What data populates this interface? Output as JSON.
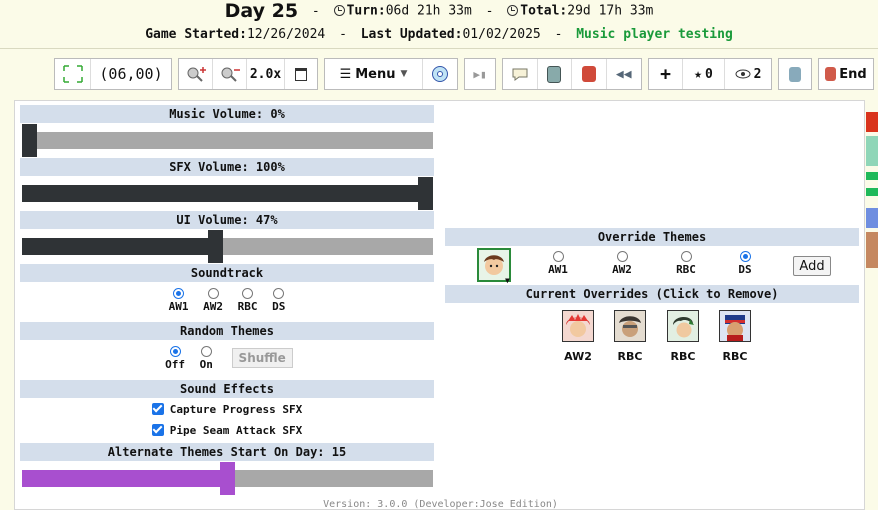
{
  "header": {
    "day": "Day 25",
    "turn_label": "Turn:",
    "turn_value": "06d 21h 33m",
    "total_label": "Total:",
    "total_value": "29d 17h 33m",
    "started_label": "Game Started:",
    "started_value": "12/26/2024",
    "updated_label": "Last Updated:",
    "updated_value": "01/02/2025",
    "status": "Music player testing"
  },
  "toolbar": {
    "coords": "(06,00)",
    "zoom": "2.0x",
    "menu": "Menu",
    "stars": "0",
    "views": "2",
    "end": "End"
  },
  "settings": {
    "music_volume": {
      "label": "Music Volume: 0%",
      "value": 0
    },
    "sfx_volume": {
      "label": "SFX Volume: 100%",
      "value": 100
    },
    "ui_volume": {
      "label": "UI Volume: 47%",
      "value": 47
    },
    "soundtrack": {
      "label": "Soundtrack",
      "options": [
        "AW1",
        "AW2",
        "RBC",
        "DS"
      ],
      "selected": "AW1"
    },
    "random_themes": {
      "label": "Random Themes",
      "options": [
        "Off",
        "On"
      ],
      "selected": "Off",
      "shuffle": "Shuffle"
    },
    "sound_effects": {
      "label": "Sound Effects",
      "capture": "Capture Progress SFX",
      "pipe": "Pipe Seam Attack SFX"
    },
    "alt_themes": {
      "label": "Alternate Themes Start On Day: 15",
      "value": 15
    }
  },
  "overrides": {
    "title": "Override Themes",
    "options": [
      "AW1",
      "AW2",
      "RBC",
      "DS"
    ],
    "selected": "DS",
    "add": "Add",
    "current_title": "Current Overrides (Click to Remove)",
    "current": [
      "AW2",
      "RBC",
      "RBC",
      "RBC"
    ]
  },
  "footer": {
    "version": "Version: 3.0.0 (Developer:Jose Edition)"
  },
  "colors": {
    "accent": "#1a73e8",
    "slider_dark": "#2f3336",
    "slider_purple": "#a84fcf",
    "section_bg": "#d4deeb",
    "status_green": "#1a9a3a"
  }
}
